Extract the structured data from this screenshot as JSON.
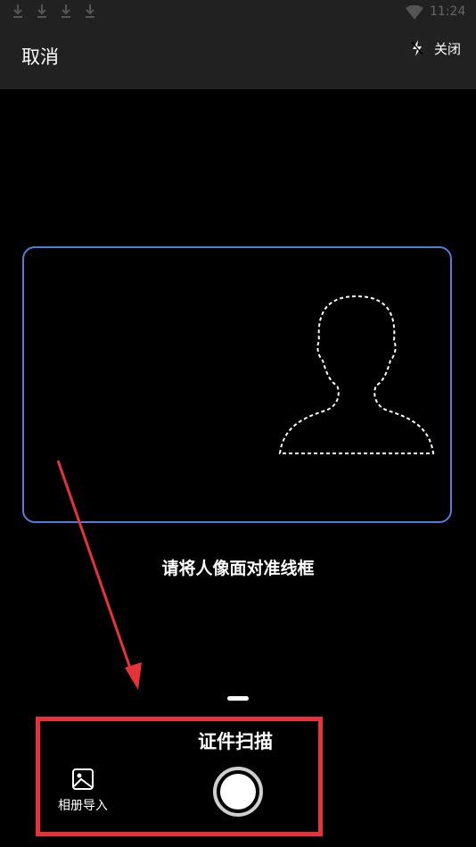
{
  "status_bar": {
    "time": "11:24",
    "icons": [
      "download-icon",
      "download-icon",
      "download-icon",
      "download-icon",
      "wifi-icon"
    ]
  },
  "toolbar": {
    "cancel_label": "取消",
    "flash_label": "关闭"
  },
  "scanner": {
    "hint": "请将人像面对准线框"
  },
  "bottom": {
    "mode_label": "证件扫描",
    "album_label": "相册导入"
  },
  "colors": {
    "frame": "#4f7fd6",
    "annotation": "#e8323a",
    "bar": "#212121"
  }
}
